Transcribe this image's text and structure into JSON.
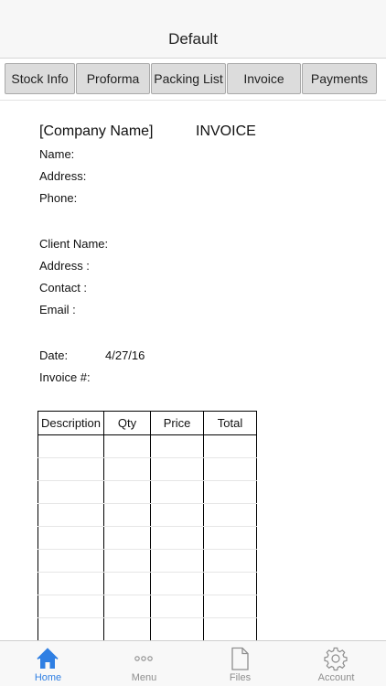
{
  "nav": {
    "title": "Default"
  },
  "tabs": [
    {
      "label": "Stock Info"
    },
    {
      "label": "Proforma"
    },
    {
      "label": "Packing List"
    },
    {
      "label": "Invoice"
    },
    {
      "label": "Payments"
    }
  ],
  "document": {
    "company": "[Company Name]",
    "heading": "INVOICE",
    "company_fields": {
      "name": "Name:",
      "address": "Address:",
      "phone": "Phone:"
    },
    "client_fields": {
      "name": "Client Name:",
      "address": "Address :",
      "contact": "Contact :",
      "email": "Email :"
    },
    "date_label": "Date:",
    "date_value": "4/27/16",
    "invoice_no_label": "Invoice #:",
    "table": {
      "headers": [
        "Description",
        "Qty",
        "Price",
        "Total"
      ]
    }
  },
  "tabbar": {
    "items": [
      {
        "label": "Home",
        "icon": "home-icon",
        "active": true
      },
      {
        "label": "Menu",
        "icon": "more-dots-icon",
        "active": false
      },
      {
        "label": "Files",
        "icon": "file-icon",
        "active": false
      },
      {
        "label": "Account",
        "icon": "gear-icon",
        "active": false
      }
    ],
    "active_color": "#2f7fe3",
    "inactive_color": "#8e8e8e"
  }
}
